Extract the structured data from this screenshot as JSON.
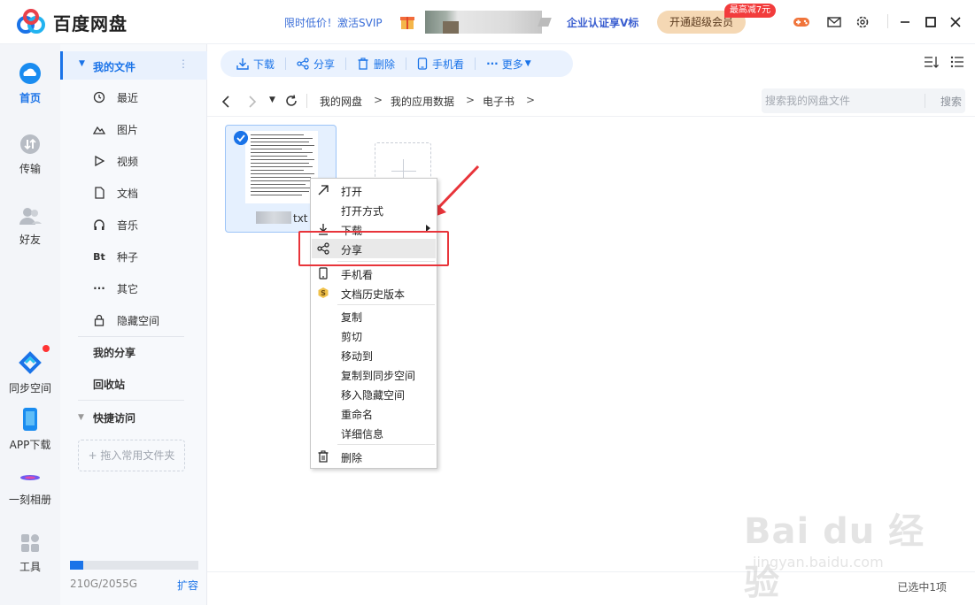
{
  "app": {
    "title": "百度网盘"
  },
  "header": {
    "promo_text": "限时低价！激活SVIP",
    "enterprise_text": "企业认证享V标",
    "svip_button": "开通超级会员",
    "svip_badge": "最高减7元"
  },
  "leftnav": {
    "items": [
      {
        "label": "首页",
        "icon": "cloud-icon"
      },
      {
        "label": "传输",
        "icon": "transfer-icon"
      },
      {
        "label": "好友",
        "icon": "friends-icon"
      },
      {
        "label": "同步空间",
        "icon": "sync-icon"
      },
      {
        "label": "APP下载",
        "icon": "phone-icon"
      },
      {
        "label": "一刻相册",
        "icon": "album-icon"
      },
      {
        "label": "工具",
        "icon": "tools-icon"
      }
    ]
  },
  "sidebar": {
    "my_files": "我的文件",
    "sub_items": [
      {
        "label": "最近",
        "icon": "clock-icon"
      },
      {
        "label": "图片",
        "icon": "image-icon"
      },
      {
        "label": "视频",
        "icon": "play-icon"
      },
      {
        "label": "文档",
        "icon": "document-icon"
      },
      {
        "label": "音乐",
        "icon": "headphones-icon"
      },
      {
        "label": "种子",
        "icon": "bt-icon"
      },
      {
        "label": "其它",
        "icon": "more-icon"
      },
      {
        "label": "隐藏空间",
        "icon": "lock-icon"
      }
    ],
    "my_share": "我的分享",
    "recycle": "回收站",
    "quick_access": "快捷访问",
    "drag_hint": "+ 拖入常用文件夹",
    "quota_text": "210G/2055G",
    "quota_fraction": 0.102,
    "expand_label": "扩容"
  },
  "toolbar": {
    "download": "下载",
    "share": "分享",
    "delete": "删除",
    "phone_view": "手机看",
    "more": "更多"
  },
  "address": {
    "crumbs": [
      "我的网盘",
      "我的应用数据",
      "电子书"
    ],
    "separator": ">",
    "search_placeholder": "搜索我的网盘文件",
    "search_button": "搜索"
  },
  "file": {
    "name_suffix": "txt"
  },
  "context_menu": {
    "items": [
      "打开",
      "打开方式",
      "下载",
      "分享",
      "手机看",
      "文档历史版本",
      "复制",
      "剪切",
      "移动到",
      "复制到同步空间",
      "移入隐藏空间",
      "重命名",
      "详细信息",
      "删除"
    ]
  },
  "status": {
    "selected": "已选中1项"
  },
  "watermark": {
    "line1": "Bai du 经验",
    "line2": "jingyan.baidu.com"
  },
  "colors": {
    "accent": "#1a73e8",
    "annotation": "#e8343a",
    "svip_bg": "#f5d8b4",
    "badge_red": "#f23c3c"
  }
}
